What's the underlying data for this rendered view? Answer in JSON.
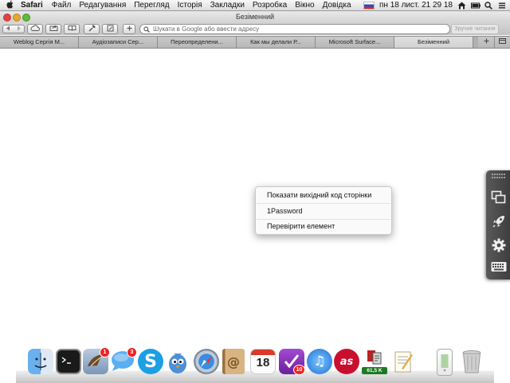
{
  "menubar": {
    "app_name": "Safari",
    "items": [
      "Файл",
      "Редагування",
      "Перегляд",
      "Історія",
      "Закладки",
      "Розробка",
      "Вікно",
      "Довідка"
    ],
    "clock": "пн 18 лист.  21 29 18"
  },
  "window": {
    "title": "Безіменний"
  },
  "toolbar": {
    "url_placeholder": "Шукати в Google або ввести адресу",
    "reader_label": "Зручне читання"
  },
  "tabs": [
    {
      "label": "Weblog Сергія М..."
    },
    {
      "label": "Аудіозаписи Сер..."
    },
    {
      "label": "Переопределени..."
    },
    {
      "label": "Как мы делали Р..."
    },
    {
      "label": "Microsoft Surface..."
    },
    {
      "label": "Безіменний"
    }
  ],
  "context_menu": {
    "items": [
      "Показати вихідний код сторінки",
      "1Password",
      "Перевірити елемент"
    ]
  },
  "dock": {
    "items": [
      {
        "icon": "finder-icon"
      },
      {
        "icon": "terminal-icon"
      },
      {
        "icon": "mail-icon",
        "badge": "1"
      },
      {
        "icon": "messages-icon",
        "badge": "3"
      },
      {
        "icon": "skype-icon"
      },
      {
        "icon": "twitterrific-icon"
      },
      {
        "icon": "safari-icon"
      },
      {
        "icon": "contacts-icon"
      },
      {
        "icon": "calendar-icon",
        "text": "18"
      },
      {
        "icon": "omnifocus-icon",
        "badge": "10"
      },
      {
        "icon": "itunes-icon"
      },
      {
        "icon": "lastfm-icon"
      },
      {
        "icon": "activity-icon",
        "label": "61,5 K"
      },
      {
        "icon": "textedit-icon"
      },
      {
        "icon": "iphone-icon"
      },
      {
        "icon": "trash-icon"
      }
    ]
  },
  "colors": {
    "menu_bg": "#e4e4e4",
    "lastfm": "#c8102e",
    "skype": "#1c9fe3"
  }
}
